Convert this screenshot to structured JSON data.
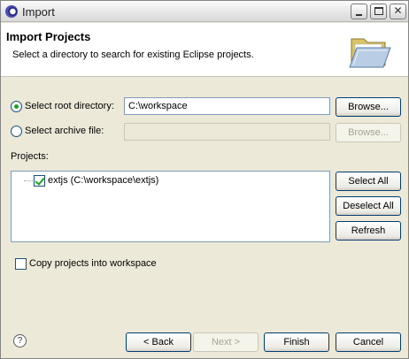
{
  "window": {
    "title": "Import",
    "icon": "eclipse-icon",
    "controls": [
      "minimize-icon",
      "maximize-icon",
      "close-icon"
    ]
  },
  "banner": {
    "title": "Import Projects",
    "description": "Select a directory to search for existing Eclipse projects.",
    "icon": "folder-icon"
  },
  "source": {
    "root_label": "Select root directory:",
    "root_value": "C:\\workspace",
    "root_selected": true,
    "archive_label": "Select archive file:",
    "archive_value": "",
    "archive_selected": false,
    "browse_label": "Browse...",
    "browse_archive_label": "Browse..."
  },
  "projects": {
    "label": "Projects:",
    "items": [
      {
        "label": "extjs (C:\\workspace\\extjs)",
        "checked": true
      }
    ],
    "select_all": "Select All",
    "deselect_all": "Deselect All",
    "refresh": "Refresh"
  },
  "options": {
    "copy_label": "Copy projects into workspace",
    "copy_checked": false
  },
  "footer": {
    "help_glyph": "?",
    "back": "< Back",
    "next": "Next >",
    "finish": "Finish",
    "cancel": "Cancel"
  },
  "colors": {
    "dialog_bg": "#ece9d8",
    "accent_green": "#21a121",
    "input_border": "#7f9db9"
  }
}
